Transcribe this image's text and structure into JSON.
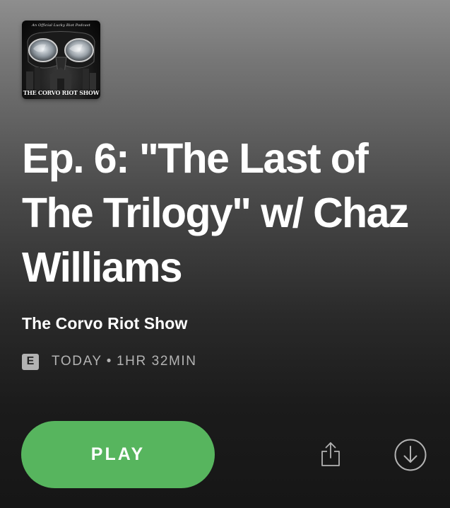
{
  "cover": {
    "tagline": "An Official Lucky Riot Podcast",
    "title": "THE CORVO RIOT SHOW"
  },
  "episode": {
    "title": "Ep. 6: \"The Last of The Trilogy\" w/ Chaz Williams",
    "show_name": "The Corvo Riot Show",
    "explicit_badge": "E",
    "date": "TODAY",
    "separator": "•",
    "duration": "1HR 32MIN"
  },
  "actions": {
    "play_label": "PLAY",
    "share_icon": "share-icon",
    "download_icon": "download-icon"
  },
  "colors": {
    "play_button": "#57b55e",
    "secondary_text": "#b3b3b3",
    "explicit_badge_bg": "#b3b3b3"
  }
}
